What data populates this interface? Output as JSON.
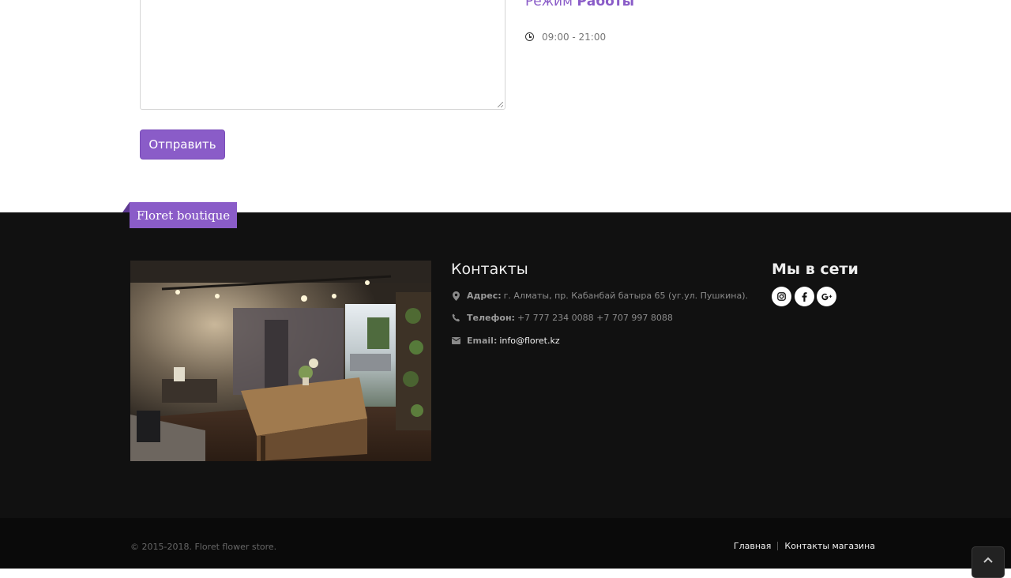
{
  "contact_form": {
    "send_button_label": "Отправить"
  },
  "working_hours": {
    "title_prefix": "Режим",
    "title_bold": "Работы",
    "hours": "09:00 - 21:00"
  },
  "footer": {
    "brand": "Floret boutique",
    "contacts": {
      "title": "Контакты",
      "address_label": "Адрес:",
      "address_value": "г. Алматы, пр. Кабанбай батыра 65 (уг.ул. Пушкина).",
      "phone_label": "Телефон:",
      "phone_value": "+7 777 234 0088 +7 707 997 8088",
      "email_label": "Email:",
      "email_value": "info@floret.kz"
    },
    "social": {
      "title": "Мы в сети",
      "buttons": [
        "instagram-icon",
        "facebook-icon",
        "google-plus-icon"
      ]
    }
  },
  "bottom_bar": {
    "copyright": "© 2015-2018. Floret flower store.",
    "nav": [
      "Главная",
      "Контакты магазина"
    ]
  },
  "colors": {
    "accent": "#8a5cc8",
    "footer_bg": "#111111",
    "bottom_bg": "#0a0a0a"
  }
}
